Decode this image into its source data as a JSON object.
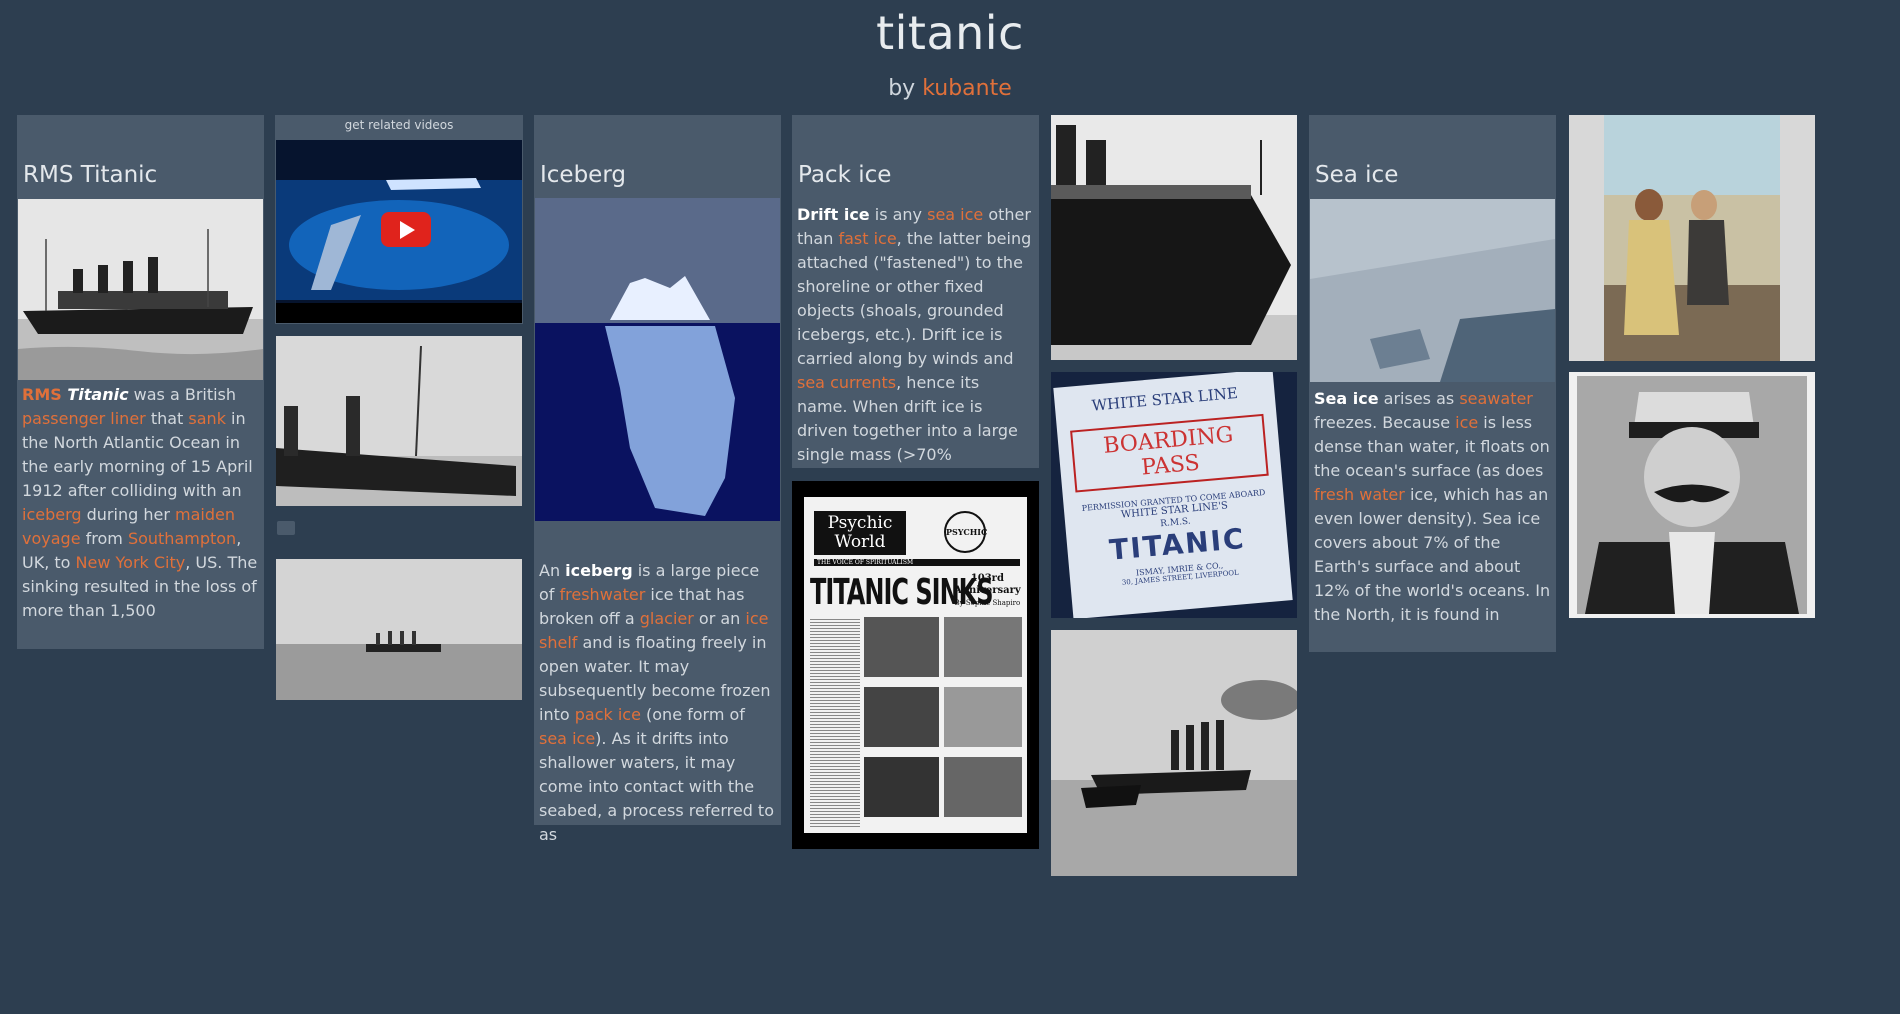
{
  "header": {
    "title": "titanic",
    "by_label": "by",
    "author": "kubante"
  },
  "col1": {
    "heading": "RMS Titanic",
    "p": {
      "rms": "RMS ",
      "titanic": "Titanic",
      "t1": " was a British ",
      "l_passenger": "passenger liner",
      "t2": " that ",
      "l_sank": "sank",
      "t3": " in the North Atlantic Ocean in the early morning of 15 April 1912 after colliding with an ",
      "l_iceberg": "iceberg",
      "t4": " during her ",
      "l_maiden": "maiden voyage",
      "t5": " from ",
      "l_southampton": "Southampton",
      "t6": ", UK, to ",
      "l_nyc": "New York City",
      "t7": ", US. The sinking resulted in the loss of more than 1,500"
    }
  },
  "col2": {
    "video_label": "get related videos"
  },
  "col3": {
    "heading": "Iceberg",
    "p": {
      "t0": "An ",
      "b": "iceberg",
      "t1": " is a large piece of ",
      "l_freshwater": "freshwater",
      "t2": " ice that has broken off a ",
      "l_glacier": "glacier",
      "t3": " or an ",
      "l_iceshelf": "ice shelf",
      "t4": " and is floating freely in open water. It may subsequently become frozen into ",
      "l_packice": "pack ice",
      "t5": " (one form of ",
      "l_seaice": "sea ice",
      "t6": "). As it drifts into shallower waters, it may come into contact with the seabed, a process referred to as"
    }
  },
  "col4": {
    "heading": "Pack ice",
    "p": {
      "b": "Drift ice",
      "t1": " is any ",
      "l_seaice": "sea ice",
      "t2": " other than ",
      "l_fastice": "fast ice",
      "t3": ", the latter being attached (\"fastened\") to the shoreline or other fixed objects (shoals, grounded icebergs, etc.). Drift ice is carried along by winds and ",
      "l_currents": "sea currents",
      "t4": ", hence its name. When drift ice is driven together into a large single mass (>70%"
    },
    "newspaper": {
      "masthead1": "Psychic",
      "masthead2": "World",
      "logo": "PSYCHIC",
      "tagline": "THE VOICE OF SPIRITUALISM",
      "headline": "TITANIC SINKS",
      "sub1": "103rd",
      "sub2": "Anniversary",
      "byline": "By Sophie Shapiro"
    }
  },
  "col5": {
    "pass": {
      "line": "WHITE STAR LINE",
      "title": "BOARDING PASS",
      "perm1": "PERMISSION GRANTED TO COME ABOARD",
      "perm2": "WHITE STAR LINE'S",
      "rms": "R.M.S.",
      "ship": "TITANIC",
      "addr1": "ISMAY, IMRIE & CO.,",
      "addr2": "30, JAMES STREET, LIVERPOOL"
    }
  },
  "col6": {
    "heading": "Sea ice",
    "p": {
      "b": "Sea ice",
      "t1": " arises as ",
      "l_seawater": "seawater",
      "t2": " freezes. Because ",
      "l_ice": "ice",
      "t3": " is less dense than water, it floats on the ocean's surface (as does ",
      "l_fresh": "fresh water",
      "t4": " ice, which has an even lower density). Sea ice covers about 7% of the Earth's surface and about 12% of the world's oceans. In the North, it is found in"
    }
  }
}
